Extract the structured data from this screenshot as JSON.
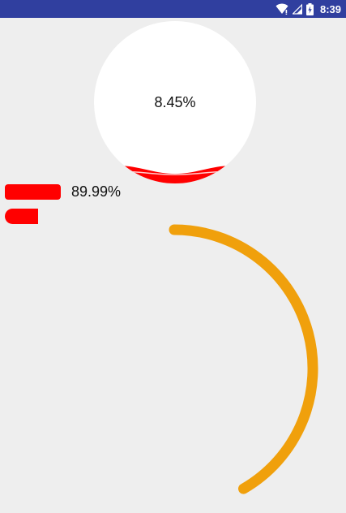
{
  "status_bar": {
    "time": "8:39",
    "icons": [
      "wifi-icon",
      "signal-icon",
      "battery-charging-icon"
    ],
    "color": "#303f9f"
  },
  "wave_progress": {
    "label": "8.45%",
    "value_fraction": 0.0845,
    "wave_color": "#ff0000",
    "circle_color": "#ffffff"
  },
  "bar_progress": {
    "label": "89.99%",
    "value_fraction": 0.8999,
    "color": "#ff0000"
  },
  "small_bar_progress": {
    "value_fraction": 0.9,
    "color": "#ff0000"
  },
  "arc_progress": {
    "color": "#f0a00c",
    "sweep_degrees": 150
  }
}
